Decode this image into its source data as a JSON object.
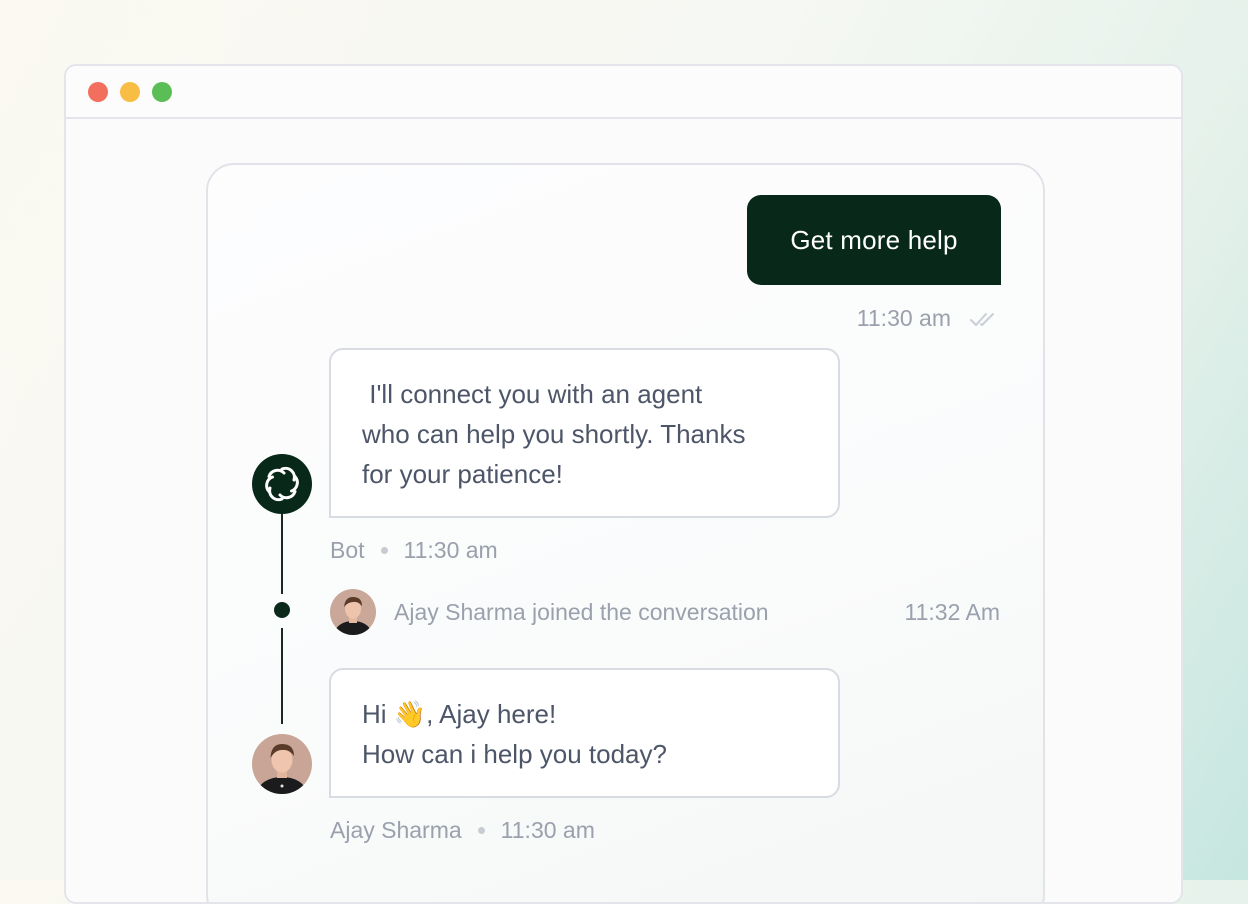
{
  "window": {
    "controls": [
      "close",
      "minimize",
      "zoom"
    ]
  },
  "chat": {
    "user_message": {
      "text": "Get more help",
      "time": "11:30 am",
      "status_icon": "double-check-icon"
    },
    "bot_message": {
      "lines": [
        " I'll connect you with an agent",
        "who can help you shortly. Thanks",
        "for your patience!"
      ],
      "sender": "Bot",
      "time": "11:30 am",
      "avatar_icon": "bot-logo-icon"
    },
    "join_event": {
      "text": "Ajay Sharma joined the conversation",
      "time": "11:32 Am"
    },
    "agent_message": {
      "lines": [
        "Hi 👋, Ajay here!",
        "How can i help you today?"
      ],
      "sender": "Ajay Sharma",
      "time": "11:30 am"
    }
  },
  "colors": {
    "user_bubble": "#08281a",
    "meta_text": "#9aa1ad",
    "bubble_text": "#4d5668"
  }
}
